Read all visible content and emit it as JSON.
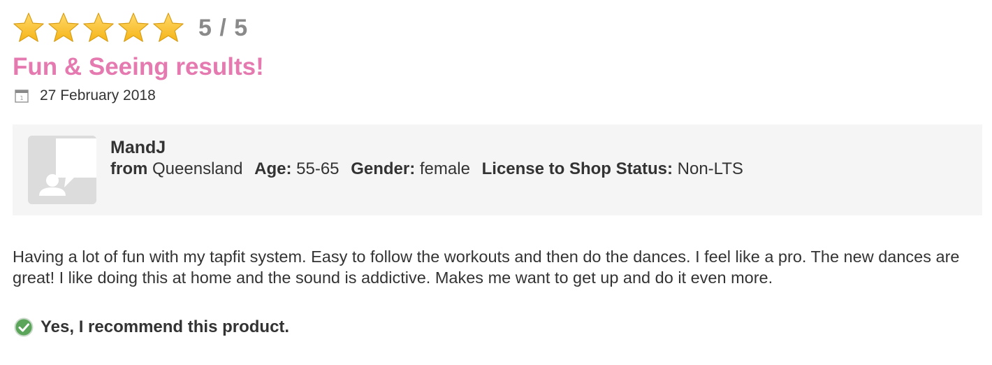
{
  "rating": {
    "value": 5,
    "max": 5,
    "label": "5 / 5",
    "star_color": "#f5b417",
    "icon": "star-icon"
  },
  "review": {
    "title": "Fun & Seeing results!",
    "title_color": "#e57ab0",
    "date": "27 February 2018",
    "body": "Having a lot of fun with my tapfit system. Easy to follow the workouts and then do the dances. I feel like a pro. The new dances are great! I like doing this at home and the sound is addictive. Makes me want to get up and do it even more."
  },
  "author": {
    "name": "MandJ",
    "from_label": "from",
    "from_value": "Queensland",
    "age_label": "Age:",
    "age_value": "55-65",
    "gender_label": "Gender:",
    "gender_value": "female",
    "status_label": "License to Shop Status:",
    "status_value": "Non-LTS",
    "avatar_icon": "default-avatar-icon"
  },
  "recommendation": {
    "text": "Yes, I recommend this product.",
    "icon": "check-circle-icon",
    "color": "#5aa55a"
  }
}
